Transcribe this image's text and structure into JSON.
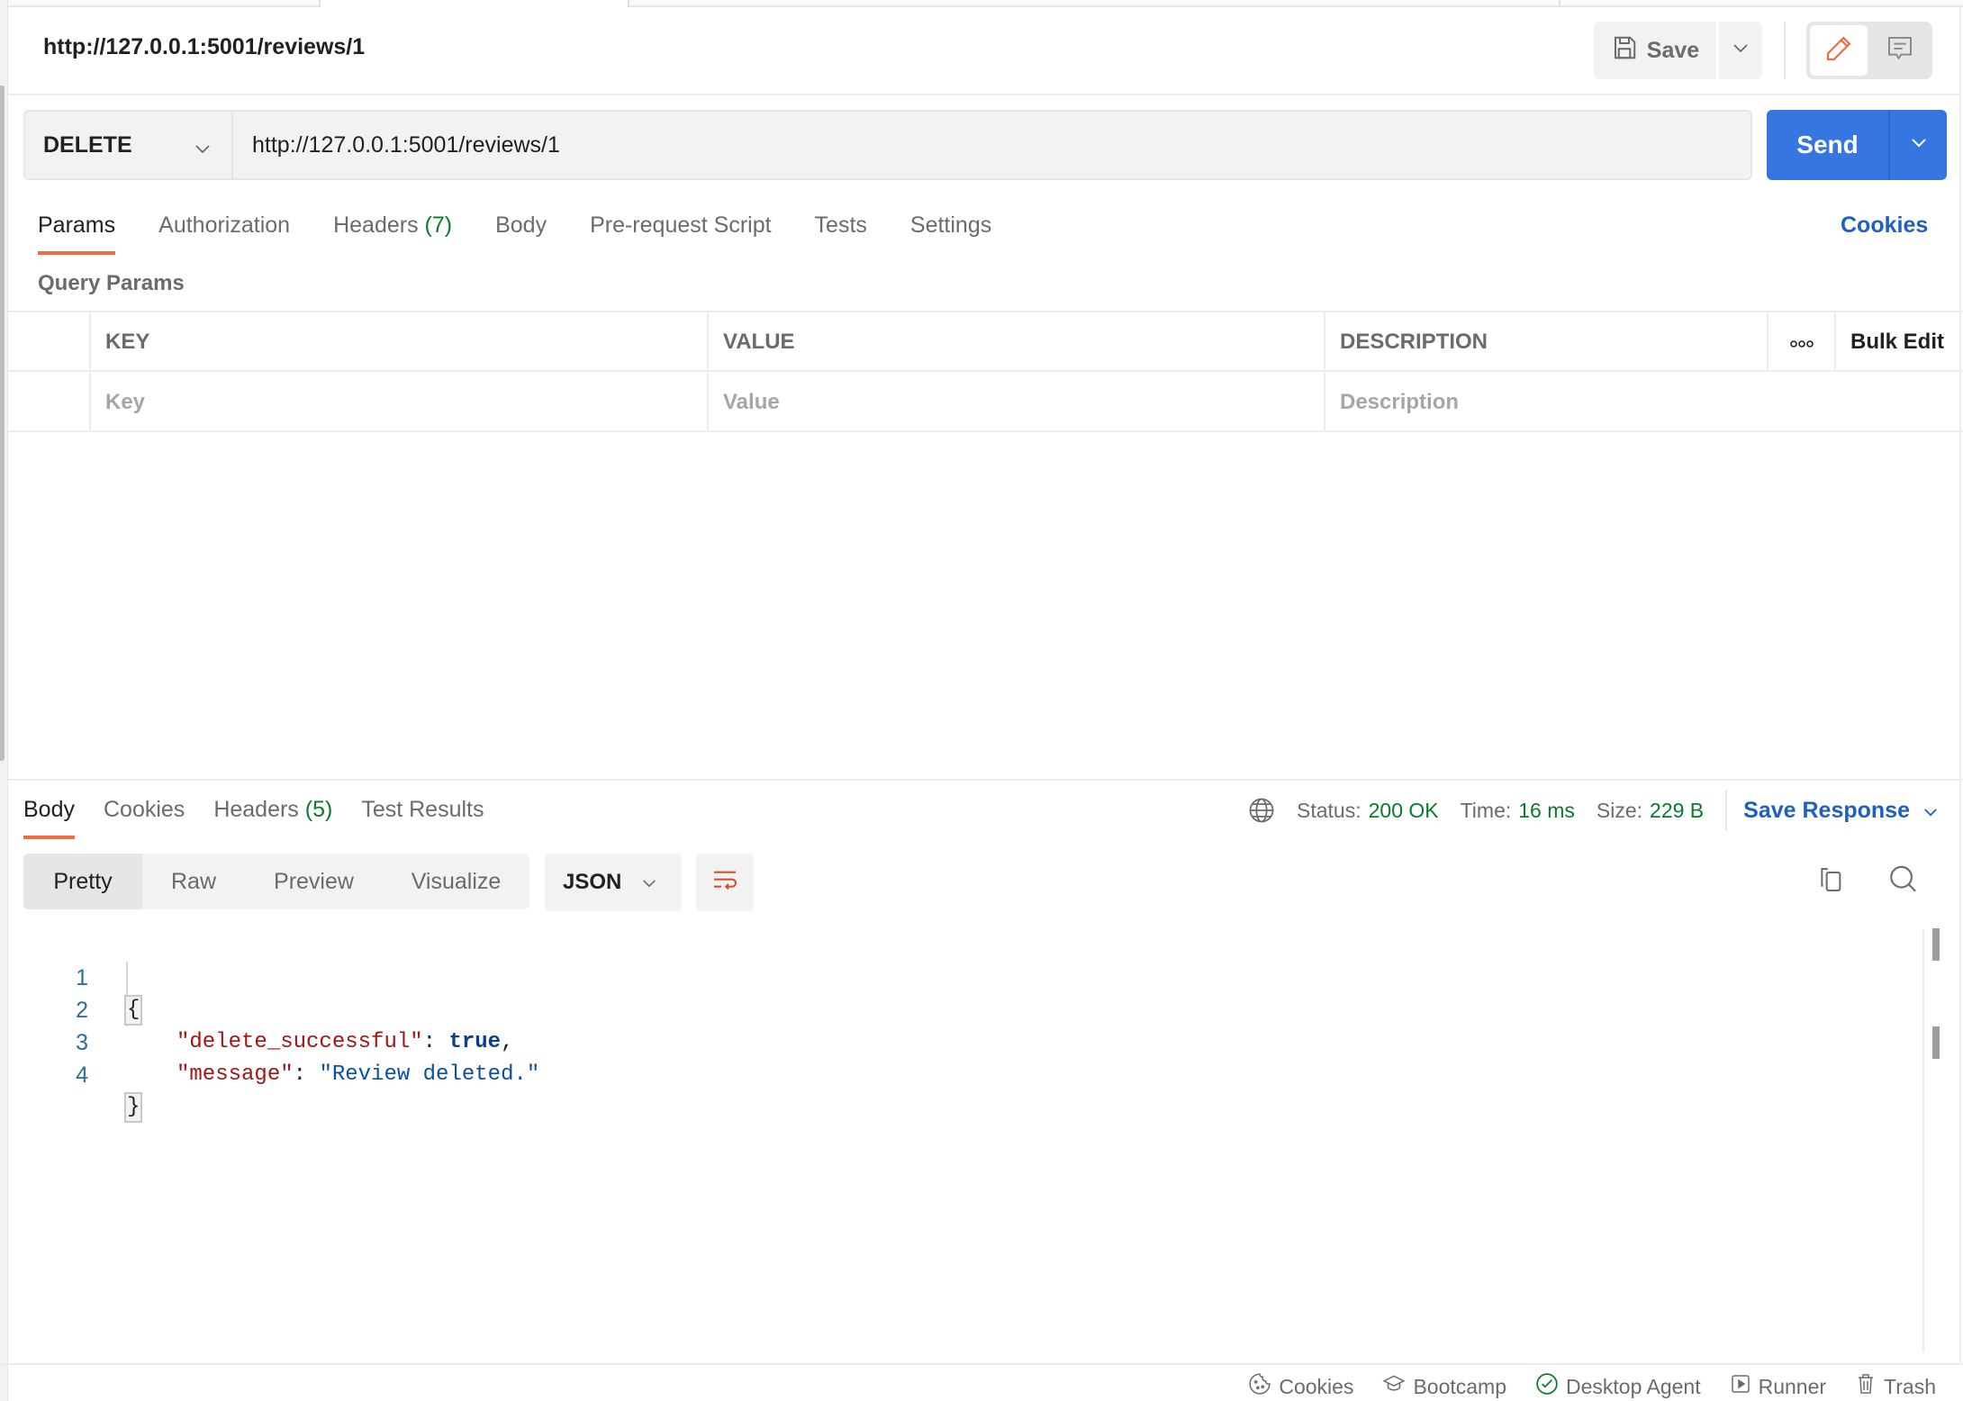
{
  "window": {
    "request_name": "http://127.0.0.1:5001/reviews/1"
  },
  "toolbar": {
    "save_label": "Save"
  },
  "request": {
    "method": "DELETE",
    "url": "http://127.0.0.1:5001/reviews/1",
    "send_label": "Send",
    "tabs": [
      {
        "label": "Params",
        "count": ""
      },
      {
        "label": "Authorization",
        "count": ""
      },
      {
        "label": "Headers",
        "count": "(7)"
      },
      {
        "label": "Body",
        "count": ""
      },
      {
        "label": "Pre-request Script",
        "count": ""
      },
      {
        "label": "Tests",
        "count": ""
      },
      {
        "label": "Settings",
        "count": ""
      }
    ],
    "active_tab": "Params",
    "cookies_link": "Cookies"
  },
  "params": {
    "section_label": "Query Params",
    "columns": [
      "KEY",
      "VALUE",
      "DESCRIPTION"
    ],
    "more_label": "ooo",
    "bulk_edit_label": "Bulk Edit",
    "placeholders": {
      "key": "Key",
      "value": "Value",
      "description": "Description"
    }
  },
  "response": {
    "tabs": [
      {
        "label": "Body",
        "count": ""
      },
      {
        "label": "Cookies",
        "count": ""
      },
      {
        "label": "Headers",
        "count": "(5)"
      },
      {
        "label": "Test Results",
        "count": ""
      }
    ],
    "active_tab": "Body",
    "status_label": "Status:",
    "status_value": "200 OK",
    "time_label": "Time:",
    "time_value": "16 ms",
    "size_label": "Size:",
    "size_value": "229 B",
    "save_response_label": "Save Response",
    "view_modes": [
      "Pretty",
      "Raw",
      "Preview",
      "Visualize"
    ],
    "active_view": "Pretty",
    "format": "JSON",
    "body_lines": [
      {
        "n": "1",
        "open": "{"
      },
      {
        "n": "2",
        "key": "\"delete_successful\"",
        "sep": ": ",
        "bool": "true",
        "end": ","
      },
      {
        "n": "3",
        "key": "\"message\"",
        "sep": ": ",
        "str": "\"Review deleted.\"",
        "end": ""
      },
      {
        "n": "4",
        "open": "}"
      }
    ]
  },
  "footer": {
    "items": [
      {
        "label": "Cookies",
        "icon": "cookie-icon"
      },
      {
        "label": "Bootcamp",
        "icon": "graduation-cap-icon"
      },
      {
        "label": "Desktop Agent",
        "icon": "check-circle-icon"
      },
      {
        "label": "Runner",
        "icon": "play-square-icon"
      },
      {
        "label": "Trash",
        "icon": "trash-icon"
      }
    ]
  },
  "colors": {
    "accent": "#ef6c3e",
    "primary": "#3576e0",
    "link": "#1d5fc2",
    "success": "#0b7a2b"
  }
}
